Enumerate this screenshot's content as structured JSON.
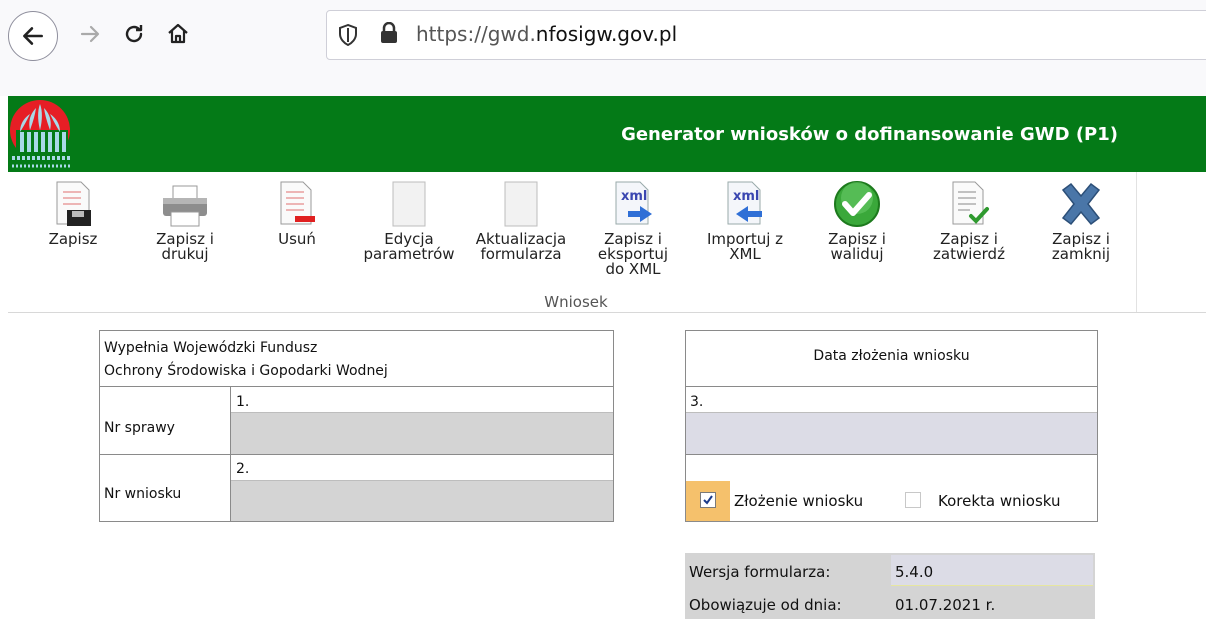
{
  "browser": {
    "url_prefix": "https://gwd.",
    "url_domain": "nfosigw.gov.pl"
  },
  "header": {
    "title": "Generator wniosków o dofinansowanie GWD (P1)"
  },
  "ribbon": {
    "group_label": "Wniosek",
    "buttons": [
      {
        "label": "Zapisz",
        "icon": "save-icon"
      },
      {
        "label": "Zapisz i\ndrukuj",
        "icon": "printer-icon"
      },
      {
        "label": "Usuń",
        "icon": "delete-document-icon"
      },
      {
        "label": "Edycja\nparametrów",
        "icon": "blank-document-icon"
      },
      {
        "label": "Aktualizacja\nformularza",
        "icon": "blank-document-icon"
      },
      {
        "label": "Zapisz i\neksportuj\ndo XML",
        "icon": "xml-export-icon"
      },
      {
        "label": "Importuj z\nXML",
        "icon": "xml-import-icon"
      },
      {
        "label": "Zapisz i\nwaliduj",
        "icon": "green-check-icon"
      },
      {
        "label": "Zapisz i\nzatwierdź",
        "icon": "document-check-icon"
      },
      {
        "label": "Zapisz i\nzamknij",
        "icon": "blue-x-icon"
      }
    ]
  },
  "fund_box": {
    "heading_line1": "Wypełnia Wojewódzki Fundusz",
    "heading_line2": "Ochrony Środowiska i Gopodarki Wodnej",
    "row1_label": "Nr sprawy",
    "row1_number": "1.",
    "row2_label": "Nr wniosku",
    "row2_number": "2."
  },
  "date_box": {
    "heading": "Data złożenia wniosku",
    "number": "3.",
    "option1_label": "Złożenie wniosku",
    "option1_checked": true,
    "option2_label": "Korekta wniosku",
    "option2_checked": false
  },
  "version": {
    "label1": "Wersja formularza:",
    "value1": "5.4.0",
    "label2": "Obowiązuje od dnia:",
    "value2": "01.07.2021 r."
  },
  "colors": {
    "header_green": "#047a17",
    "field_gray": "#d4d4d4",
    "field_lavender": "#dcdce6",
    "checkbox_highlight": "#f5c16c"
  }
}
